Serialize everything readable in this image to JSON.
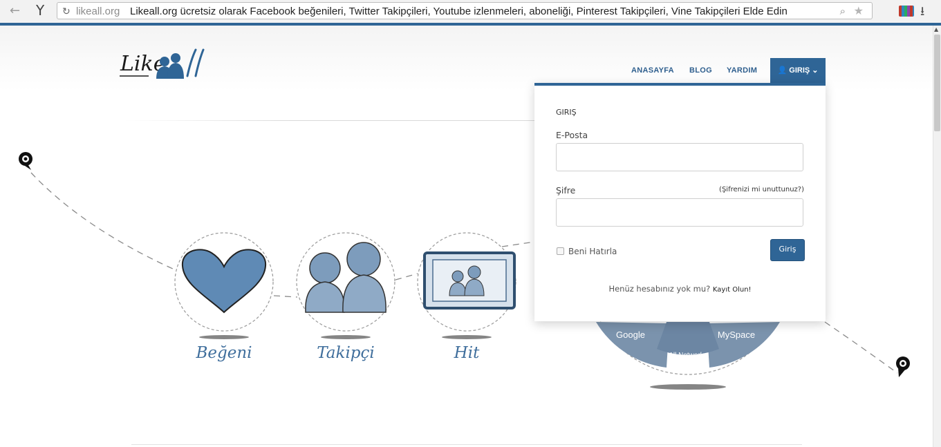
{
  "browser": {
    "url_domain": "likeall.org",
    "page_title": "Likeall.org ücretsiz olarak Facebook beğenileri, Twitter Takipçileri, Youtube izlenmeleri, aboneliği, Pinterest Takipçileri, Vine Takipçileri Elde Edin",
    "browser_logo": "Y",
    "icons": [
      "back-icon",
      "reload-icon",
      "zoom-icon",
      "bookmark-star-icon",
      "extension-icon",
      "download-icon"
    ]
  },
  "header": {
    "logo_text": "Like",
    "nav": {
      "home": "ANASAYFA",
      "blog": "BLOG",
      "help": "YARDIM",
      "login": "GIRIŞ"
    }
  },
  "login_dropdown": {
    "title": "GIRIŞ",
    "email_label": "E-Posta",
    "email_value": "",
    "password_label": "Şifre",
    "password_value": "",
    "forgot_link": "(Şifrenizi mi unuttunuz?)",
    "remember_label": "Beni Hatırla",
    "remember_checked": false,
    "submit_label": "Giriş",
    "no_account_text": "Henüz hesabınız yok mu?",
    "register_link": "Kayıt Olun!"
  },
  "services": [
    {
      "label": "Beğeni",
      "icon": "heart-icon"
    },
    {
      "label": "Takipçi",
      "icon": "followers-icon"
    },
    {
      "label": "Hit",
      "icon": "hit-screen-icon"
    }
  ],
  "networks_wheel": {
    "segments": [
      "Google",
      "All Networks",
      "MySpace"
    ]
  },
  "colors": {
    "brand_blue": "#2f6596",
    "link_blue": "#2f5f8e"
  }
}
